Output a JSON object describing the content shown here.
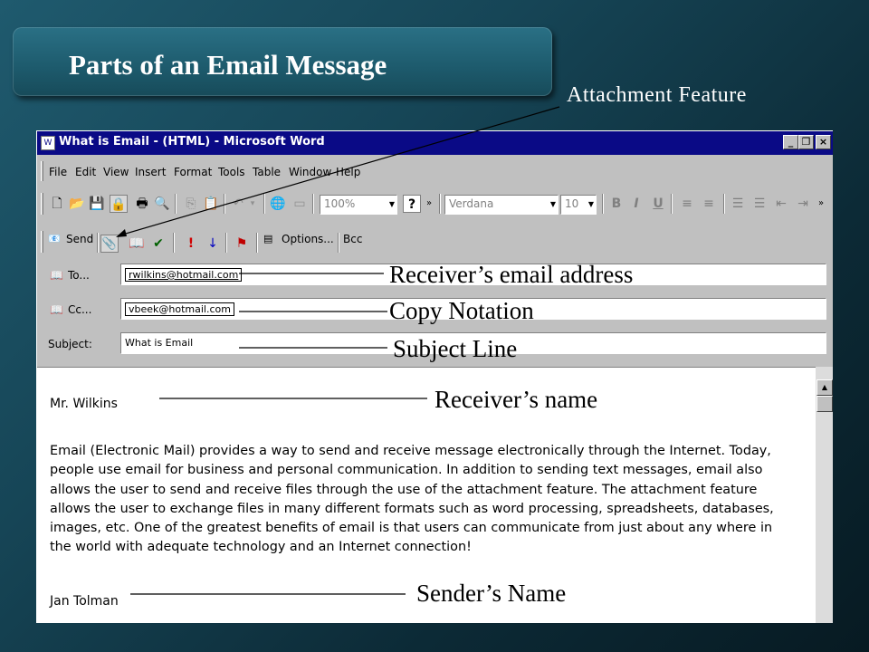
{
  "slide": {
    "title": "Parts of an Email Message",
    "callouts": {
      "attachment": "Attachment Feature",
      "receiver_email": "Receiver’s email address",
      "copy": "Copy Notation",
      "subject": "Subject Line",
      "receiver_name": "Receiver’s name",
      "sender_name": "Sender’s Name"
    }
  },
  "window": {
    "title": "What is Email - (HTML) - Microsoft Word",
    "controls": [
      "_",
      "❐",
      "×"
    ]
  },
  "menu": [
    "File",
    "Edit",
    "View",
    "Insert",
    "Format",
    "Tools",
    "Table",
    "Window",
    "Help"
  ],
  "standard_toolbar": {
    "zoom": "100%",
    "font": "Verdana",
    "size": "10",
    "bold": "B",
    "italic": "I",
    "underline": "U"
  },
  "envelope_toolbar": {
    "send": "Send",
    "options": "Options...",
    "bcc": "Bcc"
  },
  "header": {
    "to_label": "To...",
    "to_value": "rwilkins@hotmail.com",
    "cc_label": "Cc...",
    "cc_value": "vbeek@hotmail.com",
    "subject_label": "Subject:",
    "subject_value": "What is Email"
  },
  "document": {
    "salutation": "Mr. Wilkins",
    "lines": [
      "Email (Electronic Mail) provides a way to send and receive message electronically through the Internet.  Today,",
      "people use email for business and personal communication.  In addition to sending text messages, email also",
      "allows the user to send and receive files through the use of the attachment feature.  The attachment feature",
      "allows the user to exchange files in many different formats such as word processing, spreadsheets, databases,",
      "images, etc.  One of the greatest benefits of email is that users can communicate from just about any where in",
      "the world with adequate technology and an Internet connection!"
    ],
    "signature": "Jan Tolman"
  },
  "colors": {
    "title_bar": "#0a0a86",
    "slide_accent": "#1d5a6c",
    "callout_text": "#ffffff"
  }
}
